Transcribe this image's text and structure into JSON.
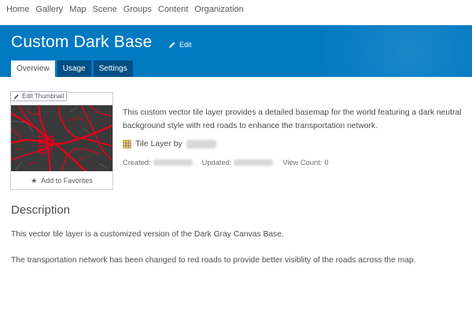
{
  "nav": {
    "items": [
      "Home",
      "Gallery",
      "Map",
      "Scene",
      "Groups",
      "Content",
      "Organization"
    ]
  },
  "header": {
    "title": "Custom Dark Base",
    "edit_label": "Edit",
    "brand_color": "#0079c1"
  },
  "tabs": [
    {
      "label": "Overview",
      "active": true
    },
    {
      "label": "Usage",
      "active": false
    },
    {
      "label": "Settings",
      "active": false
    }
  ],
  "thumbnail": {
    "edit_label": "Edit Thumbnail",
    "favorites_label": "Add to Favorites",
    "road_color": "#e3001b",
    "background_color": "#3a3a3a"
  },
  "summary": "This custom vector tile layer provides a detailed basemap for the world featuring a dark neutral background style with red roads to enhance the transportation network.",
  "item_type": {
    "label": "Tile Layer by",
    "icon": "tile-layer-icon"
  },
  "meta": {
    "created_label": "Created:",
    "updated_label": "Updated:",
    "view_count_label": "View Count:",
    "view_count": "0"
  },
  "description": {
    "heading": "Description",
    "p1": "This vector tile layer is a customized version of the Dark Gray Canvas Base.",
    "p2": "The transportation network has been changed to red roads to provide better visiblity of the roads across the map."
  }
}
